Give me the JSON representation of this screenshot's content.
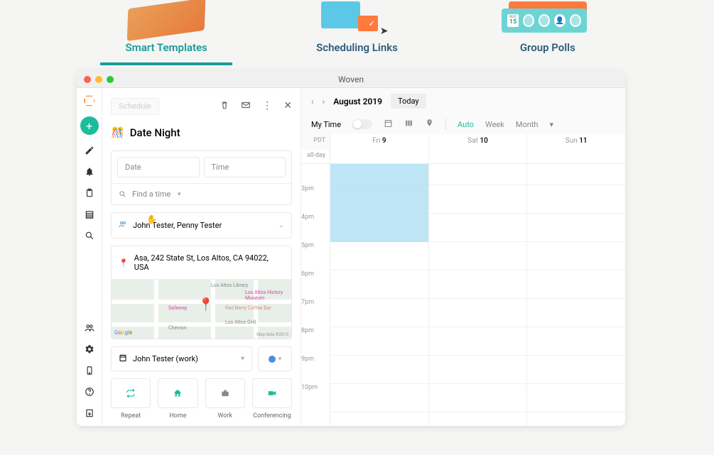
{
  "tabs": {
    "smart_templates": "Smart Templates",
    "scheduling_links": "Scheduling Links",
    "group_polls": "Group Polls",
    "poll_date": "15"
  },
  "window": {
    "title": "Woven"
  },
  "detail": {
    "schedule_btn": "Schedule",
    "event_emoji": "🎊",
    "event_title": "Date Night",
    "date_placeholder": "Date",
    "time_placeholder": "Time",
    "find_time": "Find a time",
    "people": "John Tester, Penny Tester",
    "location": "Asa, 242 State St, Los Altos, CA 94022, USA",
    "map_labels": [
      "Los Altos Library",
      "Los Altos History Museum",
      "Safeway",
      "Red Berry Coffee Bar",
      "Chevron",
      "Los Altos Grill"
    ],
    "map_attr": "Map data ©2019",
    "calendar_account": "John Tester (work)",
    "actions": {
      "repeat": "Repeat",
      "home": "Home",
      "work": "Work",
      "conferencing": "Conferencing"
    }
  },
  "calendar": {
    "month": "August 2019",
    "today": "Today",
    "my_time": "My Time",
    "views": {
      "auto": "Auto",
      "week": "Week",
      "month": "Month"
    },
    "timezone": "PDT",
    "allday": "all-day",
    "days": [
      {
        "name": "Fri",
        "num": "9"
      },
      {
        "name": "Sat",
        "num": "10"
      },
      {
        "name": "Sun",
        "num": "11"
      }
    ],
    "hours": [
      "3pm",
      "4pm",
      "5pm",
      "6pm",
      "7pm",
      "8pm",
      "9pm",
      "10pm"
    ]
  }
}
